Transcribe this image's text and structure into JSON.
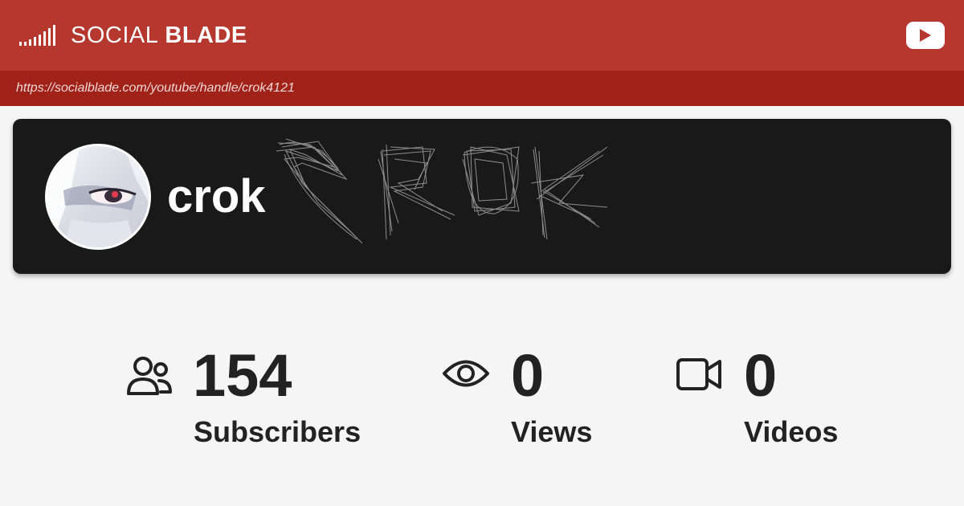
{
  "header": {
    "brand_light": "SOCIAL",
    "brand_bold": "BLADE",
    "platform_icon": "youtube-icon",
    "url": "https://socialblade.com/youtube/handle/crok4121"
  },
  "channel": {
    "name": "crok",
    "banner_lettering": "CROK"
  },
  "stats": [
    {
      "value": "154",
      "label": "Subscribers",
      "icon": "users-icon"
    },
    {
      "value": "0",
      "label": "Views",
      "icon": "eye-icon"
    },
    {
      "value": "0",
      "label": "Videos",
      "icon": "video-camera-icon"
    }
  ],
  "colors": {
    "header_bg": "#b5372d",
    "url_bar_bg": "#a02219",
    "card_bg": "#191919",
    "page_bg": "#f5f5f5",
    "text_dark": "#222222"
  }
}
